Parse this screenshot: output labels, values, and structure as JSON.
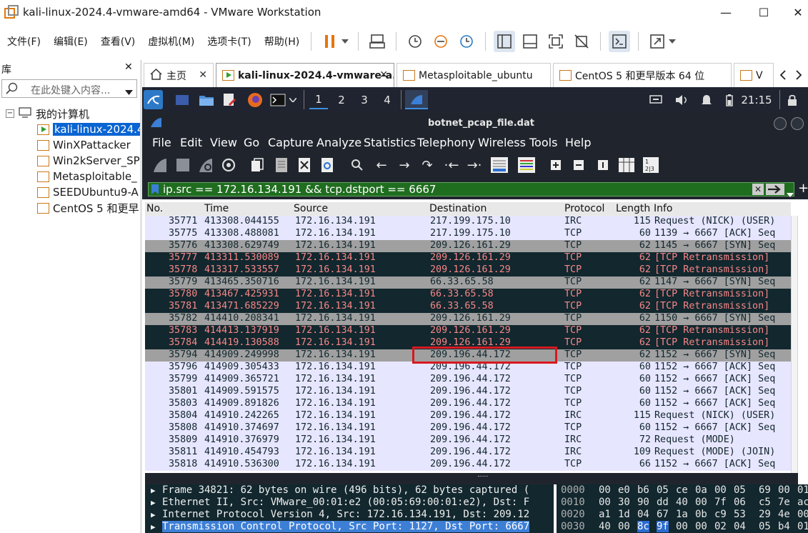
{
  "window": {
    "title": "kali-linux-2024.4-vmware-amd64 - VMware Workstation",
    "minimize": "—",
    "maximize": "☐",
    "close": "✕"
  },
  "menu": [
    "文件(F)",
    "编辑(E)",
    "查看(V)",
    "虚拟机(M)",
    "选项卡(T)",
    "帮助(H)"
  ],
  "library": {
    "title": "库",
    "close": "✕",
    "search_placeholder": "在此处键入内容...",
    "root": "我的计算机",
    "items": [
      "kali-linux-2024.4",
      "WinXPattacker",
      "Win2kServer_SP",
      "Metasploitable_",
      "SEEDUbuntu9-A",
      "CentOS 5 和更早"
    ]
  },
  "tabs": [
    {
      "label": "主页"
    },
    {
      "label": "kali-linux-2024.4-vmware-a..."
    },
    {
      "label": "Metasploitable_ubuntu"
    },
    {
      "label": "CentOS 5 和更早版本 64 位"
    },
    {
      "label": "V"
    }
  ],
  "kali_panel": {
    "workspaces": [
      "1",
      "2",
      "3",
      "4"
    ],
    "clock": "21:15"
  },
  "wireshark": {
    "file_title": "botnet_pcap_file.dat",
    "menu": [
      "File",
      "Edit",
      "View",
      "Go",
      "Capture",
      "Analyze",
      "Statistics",
      "Telephony",
      "Wireless",
      "Tools",
      "Help"
    ],
    "filter": "ip.src == 172.16.134.191 && tcp.dstport == 6667",
    "columns": [
      "No.",
      "Time",
      "Source",
      "Destination",
      "Protocol",
      "Length",
      "Info"
    ],
    "packets": [
      {
        "no": "35771",
        "time": "413308.044155",
        "src": "172.16.134.191",
        "dst": "217.199.175.10",
        "proto": "IRC",
        "len": "115",
        "info": "Request (NICK) (USER)",
        "style": "norm"
      },
      {
        "no": "35775",
        "time": "413308.488081",
        "src": "172.16.134.191",
        "dst": "217.199.175.10",
        "proto": "TCP",
        "len": "60",
        "info": "1139 → 6667 [ACK] Seq",
        "style": "norm"
      },
      {
        "no": "35776",
        "time": "413308.629749",
        "src": "172.16.134.191",
        "dst": "209.126.161.29",
        "proto": "TCP",
        "len": "62",
        "info": "1145 → 6667 [SYN] Seq",
        "style": "syn"
      },
      {
        "no": "35777",
        "time": "413311.530089",
        "src": "172.16.134.191",
        "dst": "209.126.161.29",
        "proto": "TCP",
        "len": "62",
        "info": "[TCP Retransmission]",
        "style": "bad"
      },
      {
        "no": "35778",
        "time": "413317.533557",
        "src": "172.16.134.191",
        "dst": "209.126.161.29",
        "proto": "TCP",
        "len": "62",
        "info": "[TCP Retransmission]",
        "style": "bad"
      },
      {
        "no": "35779",
        "time": "413465.350716",
        "src": "172.16.134.191",
        "dst": "66.33.65.58",
        "proto": "TCP",
        "len": "62",
        "info": "1147 → 6667 [SYN] Seq",
        "style": "syn"
      },
      {
        "no": "35780",
        "time": "413467.425931",
        "src": "172.16.134.191",
        "dst": "66.33.65.58",
        "proto": "TCP",
        "len": "62",
        "info": "[TCP Retransmission]",
        "style": "bad"
      },
      {
        "no": "35781",
        "time": "413471.685229",
        "src": "172.16.134.191",
        "dst": "66.33.65.58",
        "proto": "TCP",
        "len": "62",
        "info": "[TCP Retransmission]",
        "style": "bad"
      },
      {
        "no": "35782",
        "time": "414410.208341",
        "src": "172.16.134.191",
        "dst": "209.126.161.29",
        "proto": "TCP",
        "len": "62",
        "info": "1150 → 6667 [SYN] Seq",
        "style": "syn"
      },
      {
        "no": "35783",
        "time": "414413.137919",
        "src": "172.16.134.191",
        "dst": "209.126.161.29",
        "proto": "TCP",
        "len": "62",
        "info": "[TCP Retransmission]",
        "style": "bad"
      },
      {
        "no": "35784",
        "time": "414419.130588",
        "src": "172.16.134.191",
        "dst": "209.126.161.29",
        "proto": "TCP",
        "len": "62",
        "info": "[TCP Retransmission]",
        "style": "bad"
      },
      {
        "no": "35794",
        "time": "414909.249998",
        "src": "172.16.134.191",
        "dst": "209.196.44.172",
        "proto": "TCP",
        "len": "62",
        "info": "1152 → 6667 [SYN] Seq",
        "style": "syn"
      },
      {
        "no": "35796",
        "time": "414909.305433",
        "src": "172.16.134.191",
        "dst": "209.196.44.172",
        "proto": "TCP",
        "len": "60",
        "info": "1152 → 6667 [ACK] Seq",
        "style": "norm"
      },
      {
        "no": "35799",
        "time": "414909.365721",
        "src": "172.16.134.191",
        "dst": "209.196.44.172",
        "proto": "TCP",
        "len": "60",
        "info": "1152 → 6667 [ACK] Seq",
        "style": "norm"
      },
      {
        "no": "35801",
        "time": "414909.591575",
        "src": "172.16.134.191",
        "dst": "209.196.44.172",
        "proto": "TCP",
        "len": "60",
        "info": "1152 → 6667 [ACK] Seq",
        "style": "norm"
      },
      {
        "no": "35803",
        "time": "414909.891826",
        "src": "172.16.134.191",
        "dst": "209.196.44.172",
        "proto": "TCP",
        "len": "60",
        "info": "1152 → 6667 [ACK] Seq",
        "style": "norm"
      },
      {
        "no": "35804",
        "time": "414910.242265",
        "src": "172.16.134.191",
        "dst": "209.196.44.172",
        "proto": "IRC",
        "len": "115",
        "info": "Request (NICK) (USER)",
        "style": "norm"
      },
      {
        "no": "35808",
        "time": "414910.374697",
        "src": "172.16.134.191",
        "dst": "209.196.44.172",
        "proto": "TCP",
        "len": "60",
        "info": "1152 → 6667 [ACK] Seq",
        "style": "norm"
      },
      {
        "no": "35809",
        "time": "414910.376979",
        "src": "172.16.134.191",
        "dst": "209.196.44.172",
        "proto": "IRC",
        "len": "72",
        "info": "Request (MODE)",
        "style": "norm"
      },
      {
        "no": "35811",
        "time": "414910.454793",
        "src": "172.16.134.191",
        "dst": "209.196.44.172",
        "proto": "IRC",
        "len": "109",
        "info": "Request (MODE) (JOIN)",
        "style": "norm"
      },
      {
        "no": "35818",
        "time": "414910.536300",
        "src": "172.16.134.191",
        "dst": "209.196.44.172",
        "proto": "TCP",
        "len": "66",
        "info": "1152 → 6667 [ACK] Seq",
        "style": "norm"
      }
    ],
    "details": [
      {
        "text": "Frame 34821: 62 bytes on wire (496 bits), 62 bytes captured (",
        "selected": false
      },
      {
        "text": "Ethernet II, Src: VMware_00:01:e2 (00:05:69:00:01:e2), Dst: F",
        "selected": false
      },
      {
        "text": "Internet Protocol Version 4, Src: 172.16.134.191, Dst: 209.12",
        "selected": false
      },
      {
        "text": "Transmission Control Protocol, Src Port: 1127, Dst Port: 6667",
        "selected": true
      }
    ],
    "hex": [
      {
        "offset": "0000",
        "bytes": [
          "00",
          "e0",
          "b6",
          "05",
          "ce",
          "0a",
          "00",
          "05",
          "69",
          "00",
          "01"
        ]
      },
      {
        "offset": "0010",
        "bytes": [
          "00",
          "30",
          "90",
          "dd",
          "40",
          "00",
          "7f",
          "06",
          "c5",
          "7e",
          "ac"
        ]
      },
      {
        "offset": "0020",
        "bytes": [
          "a1",
          "1d",
          "04",
          "67",
          "1a",
          "0b",
          "c9",
          "53",
          "29",
          "4e",
          "00"
        ]
      },
      {
        "offset": "0030",
        "bytes": [
          "40",
          "00",
          "8c",
          "9f",
          "00",
          "00",
          "02",
          "04",
          "05",
          "b4",
          "01"
        ]
      }
    ],
    "hex_selected": {
      "row": 3,
      "bytes": [
        2,
        3
      ]
    }
  }
}
